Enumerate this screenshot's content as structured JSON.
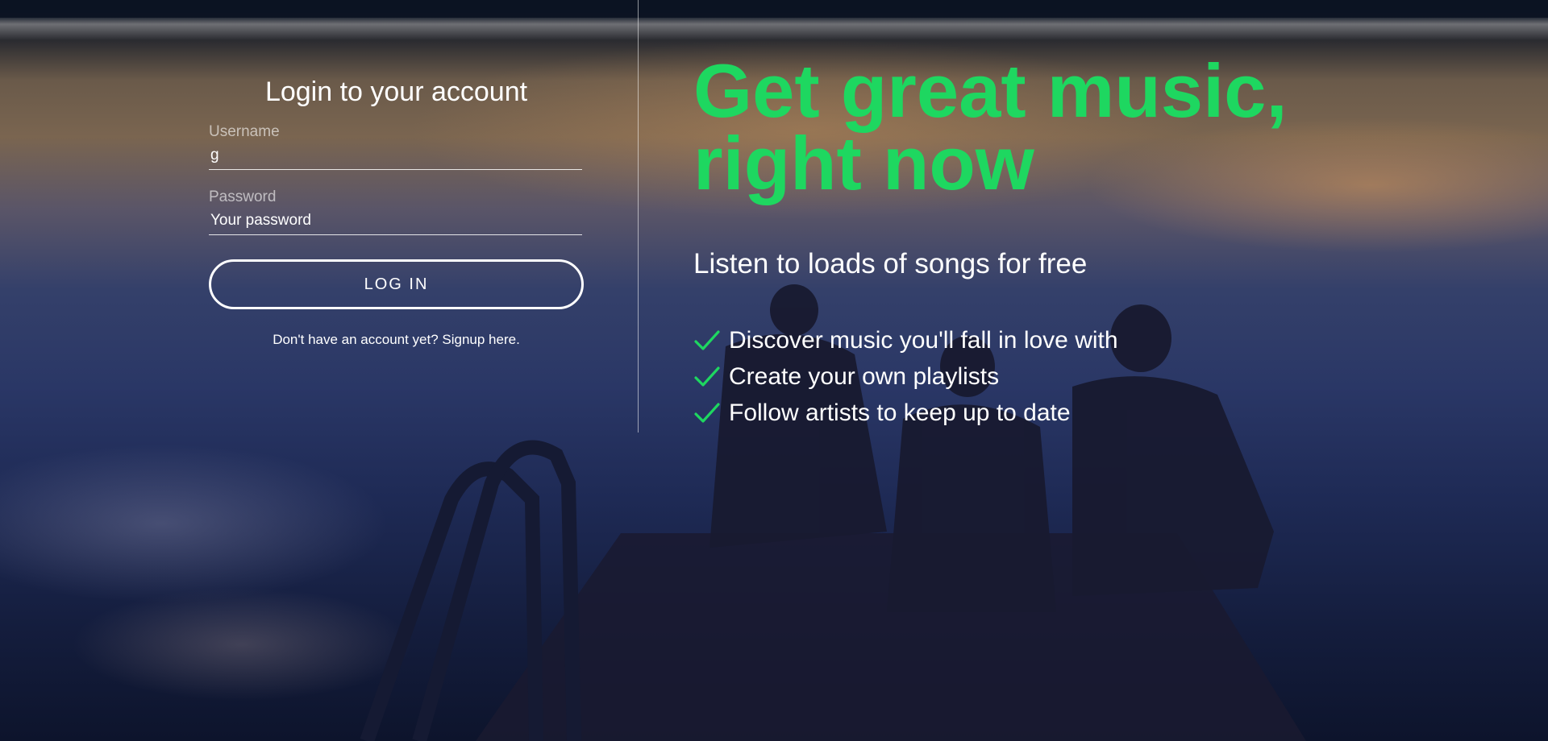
{
  "login": {
    "title": "Login to your account",
    "username_label": "Username",
    "username_value": "g",
    "password_label": "Password",
    "password_placeholder": "Your password",
    "login_button": "LOG IN",
    "signup_link": "Don't have an account yet? Signup here."
  },
  "promo": {
    "headline_line1": "Get great music,",
    "headline_line2": "right now",
    "subtitle": "Listen to loads of songs for free",
    "features": [
      {
        "text": "Discover music you'll fall in love with",
        "icon": "check-icon"
      },
      {
        "text": "Create your own playlists",
        "icon": "check-icon"
      },
      {
        "text": "Follow artists to keep up to date",
        "icon": "check-icon"
      }
    ]
  },
  "colors": {
    "accent": "#1ed760",
    "text": "#ffffff"
  }
}
